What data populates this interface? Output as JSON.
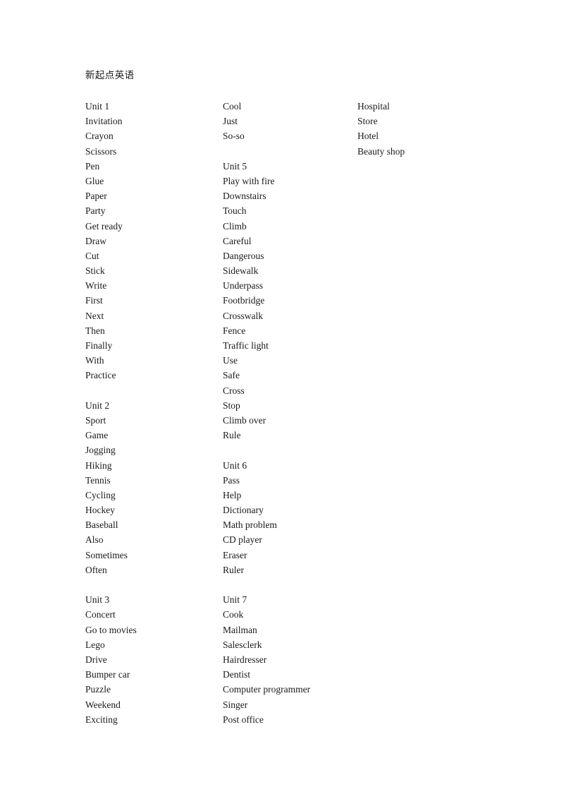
{
  "document": {
    "title": "新起点英语",
    "background_color": "#ffffff",
    "text_color": "#1a1a1a"
  },
  "columns": [
    {
      "id": "column-1",
      "entries": [
        "Unit 1",
        "Invitation",
        "Crayon",
        "Scissors",
        "Pen",
        "Glue",
        "Paper",
        "Party",
        "Get ready",
        "Draw",
        "Cut",
        "Stick",
        "Write",
        "First",
        "Next",
        "Then",
        "Finally",
        "With",
        "Practice",
        "",
        "Unit 2",
        "Sport",
        "Game",
        "Jogging",
        "Hiking",
        "Tennis",
        "Cycling",
        "Hockey",
        "Baseball",
        "Also",
        "Sometimes",
        "Often",
        "",
        "Unit 3",
        "Concert",
        "Go to movies",
        "Lego",
        "Drive",
        "Bumper car",
        "Puzzle",
        "Weekend",
        "Exciting"
      ]
    },
    {
      "id": "column-2",
      "entries": [
        "Cool",
        "Just",
        "So-so",
        "",
        "Unit 5",
        "Play with fire",
        "Downstairs",
        "Touch",
        "Climb",
        "Careful",
        "Dangerous",
        "Sidewalk",
        "Underpass",
        "Footbridge",
        "Crosswalk",
        "Fence",
        "Traffic light",
        "Use",
        "Safe",
        "Cross",
        "Stop",
        "Climb over",
        "Rule",
        "",
        "Unit 6",
        "Pass",
        "Help",
        "Dictionary",
        "Math problem",
        "CD player",
        "Eraser",
        "Ruler",
        "",
        "Unit 7",
        "Cook",
        "Mailman",
        "Salesclerk",
        "Hairdresser",
        "Dentist",
        "Computer programmer",
        "Singer",
        "Post office"
      ]
    },
    {
      "id": "column-3",
      "entries": [
        "Hospital",
        "Store",
        "Hotel",
        "Beauty shop"
      ]
    }
  ]
}
